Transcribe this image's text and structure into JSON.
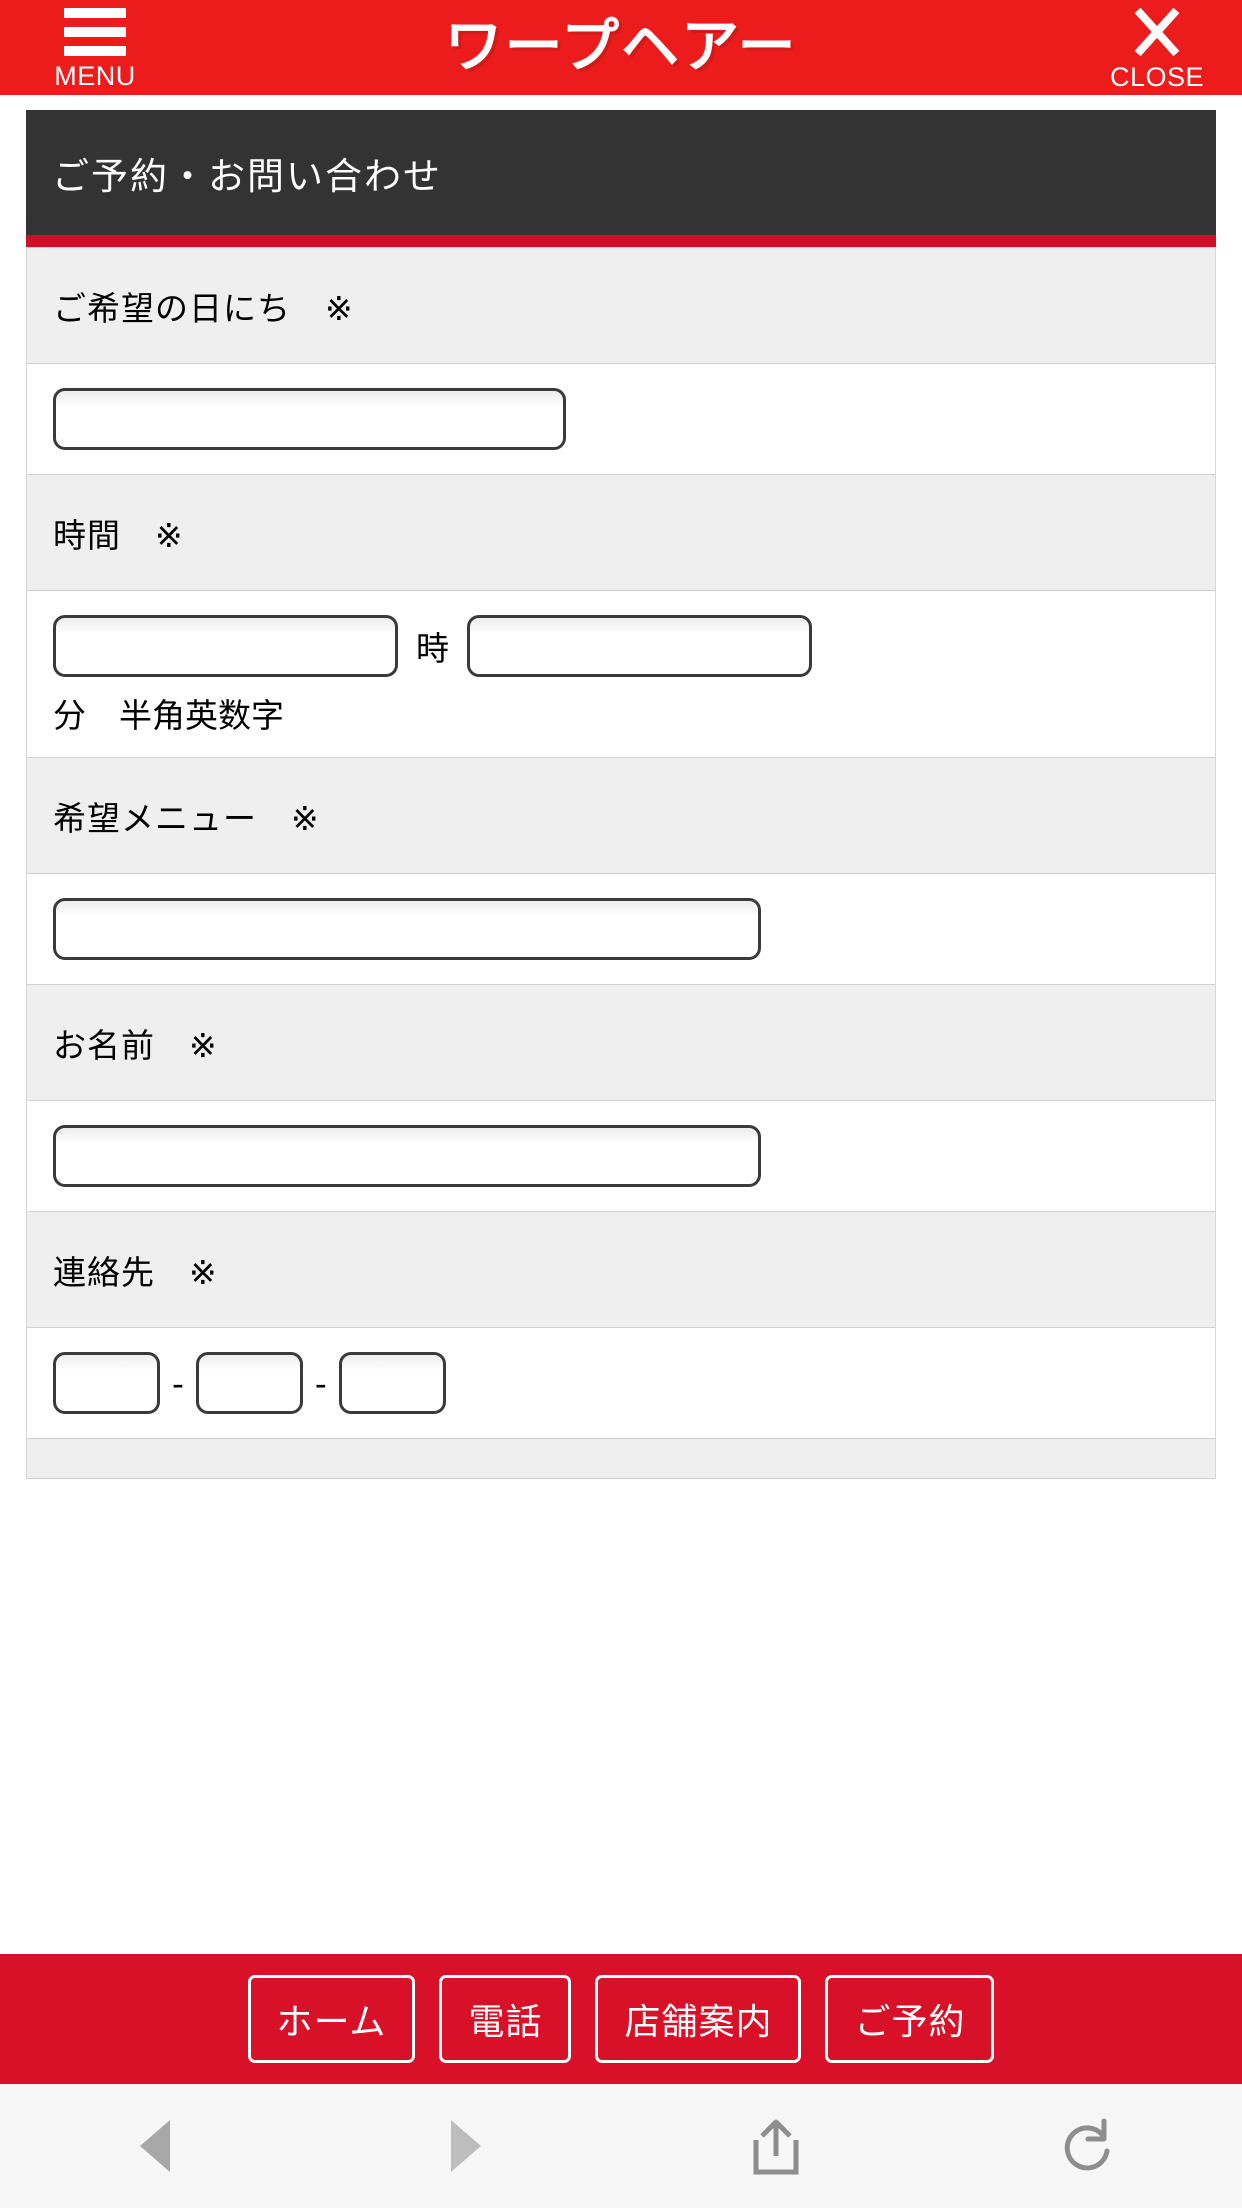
{
  "header": {
    "menu_label": "MENU",
    "logo_text": "ワープヘアー",
    "close_label": "CLOSE",
    "bg_color": "#ed1c1c"
  },
  "page": {
    "title": "ご予約・お問い合わせ",
    "title_bg": "#333333",
    "accent_color": "#cc1028"
  },
  "form": {
    "rows": [
      {
        "label": "ご希望の日にち　※"
      },
      {
        "label": "時間　※",
        "hour_unit": "時",
        "minute_note": "分　半角英数字"
      },
      {
        "label": "希望メニュー　※"
      },
      {
        "label": "お名前　※"
      },
      {
        "label": "連絡先　※",
        "tel_separator": "-"
      }
    ]
  },
  "bottom_nav": {
    "bg_color": "#d81028",
    "buttons": [
      {
        "label": "ホーム"
      },
      {
        "label": "電話"
      },
      {
        "label": "店舗案内"
      },
      {
        "label": "ご予約"
      }
    ]
  },
  "browser_toolbar": {
    "back_icon": "triangle-left-icon",
    "forward_icon": "triangle-right-icon",
    "share_icon": "share-icon",
    "reload_icon": "reload-icon"
  }
}
